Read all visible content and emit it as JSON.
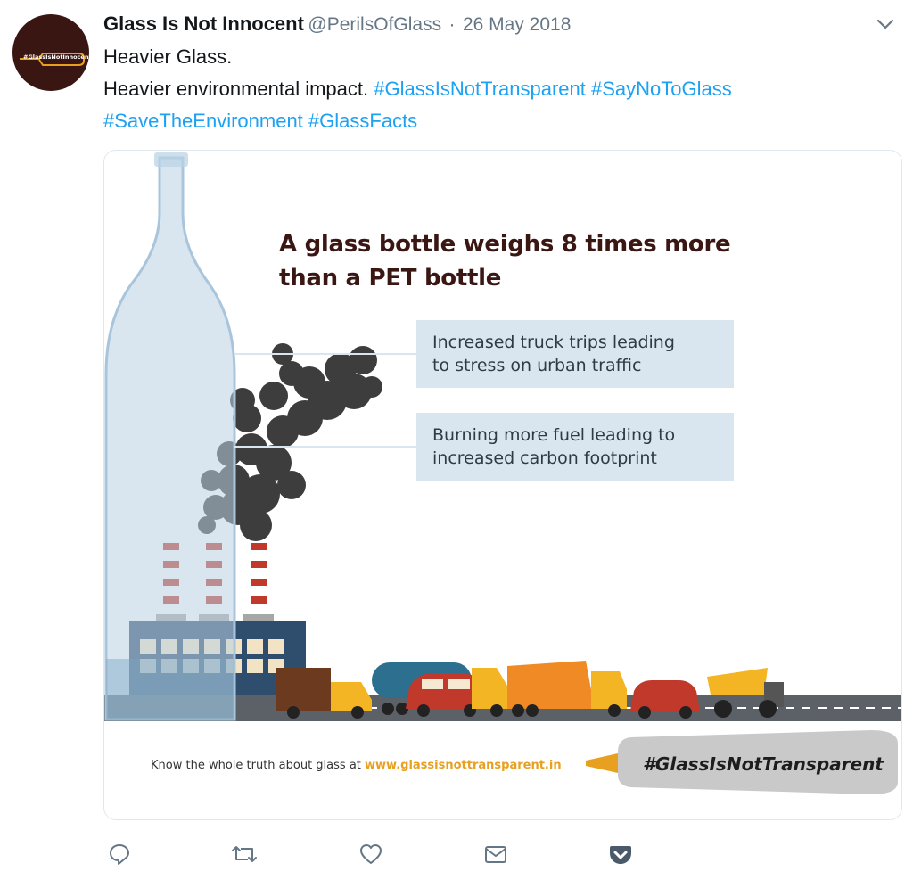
{
  "tweet": {
    "display_name": "Glass Is Not Innocent",
    "handle": "@PerilsOfGlass",
    "separator": "·",
    "date": "26 May 2018",
    "avatar_text": "#GlassIsNotInnocent",
    "line1": "Heavier Glass.",
    "line2_text": "Heavier environmental impact.",
    "hashtags": [
      "#GlassIsNotTransparent",
      "#SayNoToGlass",
      "#SaveTheEnvironment",
      "#GlassFacts"
    ]
  },
  "infographic": {
    "headline_line1": "A glass bottle weighs 8 times more",
    "headline_line2": "than a PET bottle",
    "box1_line1": "Increased truck trips leading",
    "box1_line2": "to stress on urban traffic",
    "box2_line1": "Burning more fuel leading to",
    "box2_line2": "increased carbon footprint",
    "footer_prefix": "Know the whole truth about glass at ",
    "footer_link": "www.glassisnottransparent.in",
    "bottle_hashtag": "#GlassIsNotTransparent"
  },
  "actions": [
    "reply-icon",
    "retweet-icon",
    "like-icon",
    "message-icon",
    "pocket-icon"
  ],
  "colors": {
    "hashtag": "#1da1f2",
    "muted": "#657786",
    "headline": "#3b1714",
    "infobox": "#d9e6ef",
    "footer_link": "#e8a020",
    "pocket": "#4a5a6a"
  }
}
